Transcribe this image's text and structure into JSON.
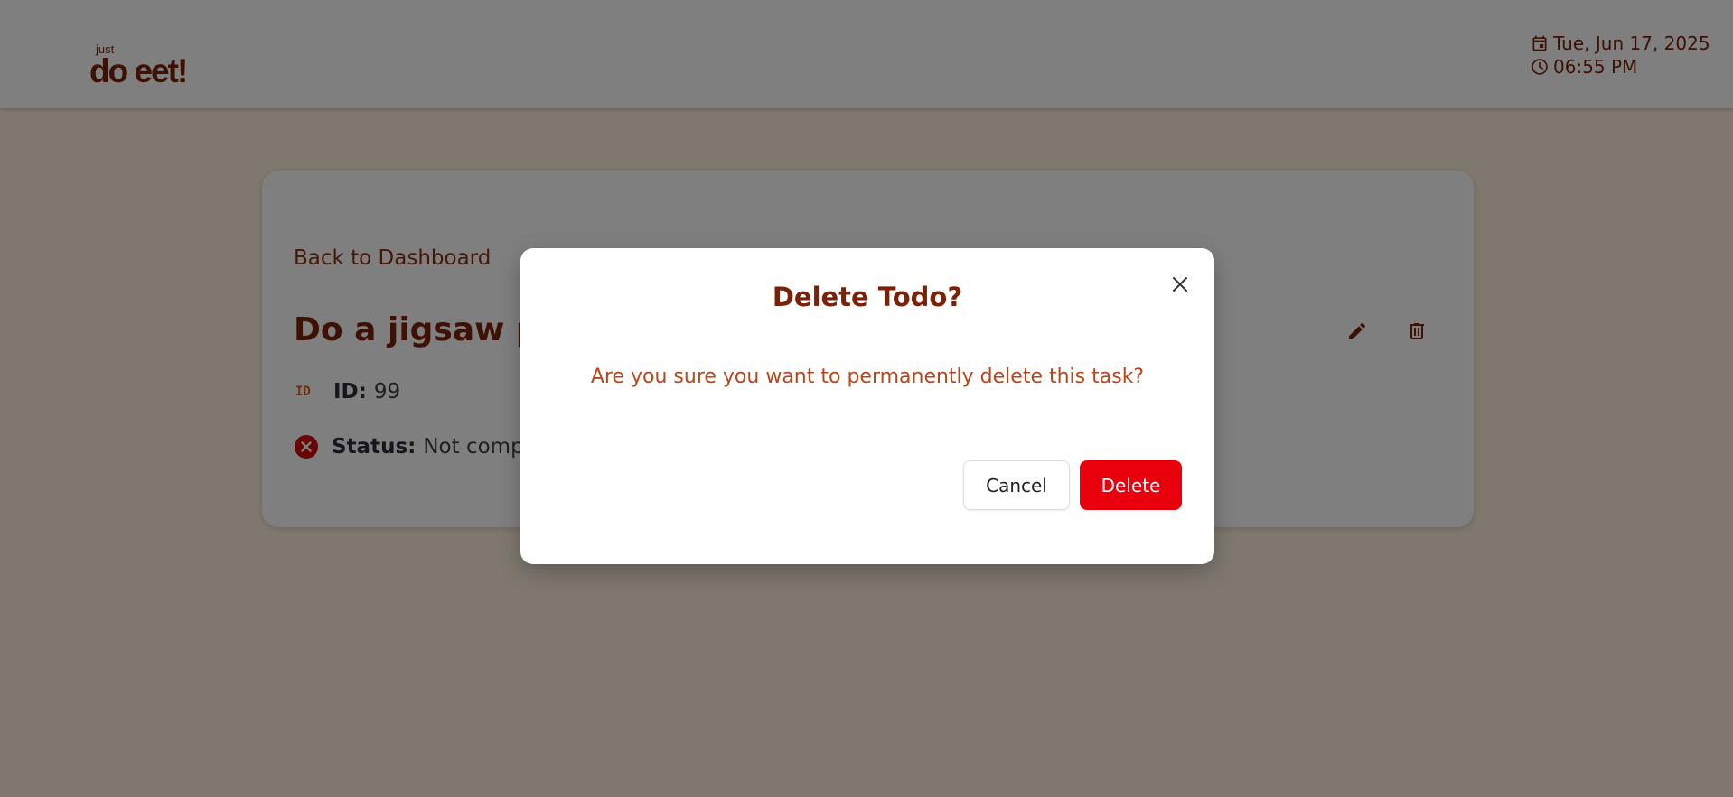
{
  "header": {
    "logo_small": "just",
    "logo_main": "do eet!",
    "date": "Tue, Jun 17, 2025",
    "time": "06:55 PM"
  },
  "card": {
    "back_link": "Back to Dashboard",
    "title": "Do a jigsaw pu",
    "id_icon_text": "ID",
    "id_label": "ID:",
    "id_value": "99",
    "status_label": "Status:",
    "status_value": "Not comple"
  },
  "modal": {
    "title": "Delete Todo?",
    "message": "Are you sure you want to permanently delete this task?",
    "cancel_label": "Cancel",
    "delete_label": "Delete"
  },
  "colors": {
    "brand": "#7a2208",
    "accent": "#e05a1a",
    "danger": "#e8000c",
    "background": "#fdf1de"
  },
  "icons": [
    "calendar-icon",
    "clock-icon",
    "edit-icon",
    "trash-icon",
    "id-icon",
    "status-x-icon",
    "close-icon"
  ]
}
